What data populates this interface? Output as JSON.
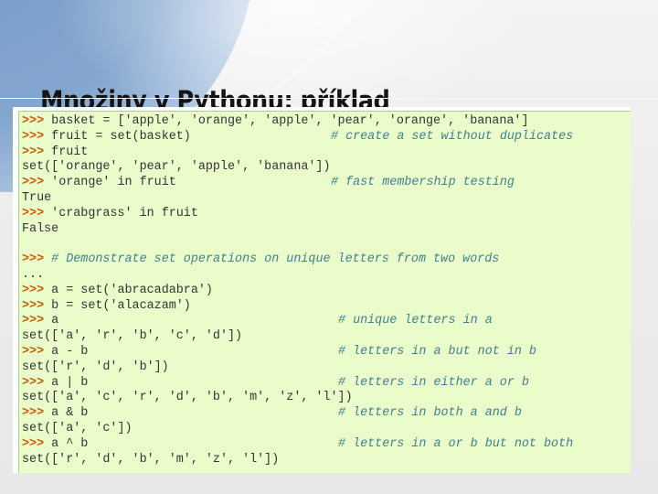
{
  "slide": {
    "title": "Množiny v Pythonu: příklad"
  },
  "code": {
    "prompt": ">>>",
    "continuation": "...",
    "lines": [
      {
        "type": "input",
        "code": "basket = ['apple', 'orange', 'apple', 'pear', 'orange', 'banana']",
        "comment": ""
      },
      {
        "type": "input",
        "code": "fruit = set(basket)",
        "comment": "# create a set without duplicates"
      },
      {
        "type": "input",
        "code": "fruit",
        "comment": ""
      },
      {
        "type": "output",
        "code": "set(['orange', 'pear', 'apple', 'banana'])",
        "comment": ""
      },
      {
        "type": "input",
        "code": "'orange' in fruit",
        "comment": "# fast membership testing"
      },
      {
        "type": "output",
        "code": "True",
        "comment": ""
      },
      {
        "type": "input",
        "code": "'crabgrass' in fruit",
        "comment": ""
      },
      {
        "type": "output",
        "code": "False",
        "comment": ""
      },
      {
        "type": "blank",
        "code": "",
        "comment": ""
      },
      {
        "type": "input",
        "code": "",
        "comment": "# Demonstrate set operations on unique letters from two words"
      },
      {
        "type": "continuation",
        "code": "",
        "comment": ""
      },
      {
        "type": "input",
        "code": "a = set('abracadabra')",
        "comment": ""
      },
      {
        "type": "input",
        "code": "b = set('alacazam')",
        "comment": ""
      },
      {
        "type": "input",
        "code": "a",
        "comment": "# unique letters in a"
      },
      {
        "type": "output",
        "code": "set(['a', 'r', 'b', 'c', 'd'])",
        "comment": ""
      },
      {
        "type": "input",
        "code": "a - b",
        "comment": "# letters in a but not in b"
      },
      {
        "type": "output",
        "code": "set(['r', 'd', 'b'])",
        "comment": ""
      },
      {
        "type": "input",
        "code": "a | b",
        "comment": "# letters in either a or b"
      },
      {
        "type": "output",
        "code": "set(['a', 'c', 'r', 'd', 'b', 'm', 'z', 'l'])",
        "comment": ""
      },
      {
        "type": "input",
        "code": "a & b",
        "comment": "# letters in both a and b"
      },
      {
        "type": "output",
        "code": "set(['a', 'c'])",
        "comment": ""
      },
      {
        "type": "input",
        "code": "a ^ b",
        "comment": "# letters in a or b but not both"
      },
      {
        "type": "output",
        "code": "set(['r', 'd', 'b', 'm', 'z', 'l'])",
        "comment": ""
      }
    ]
  }
}
